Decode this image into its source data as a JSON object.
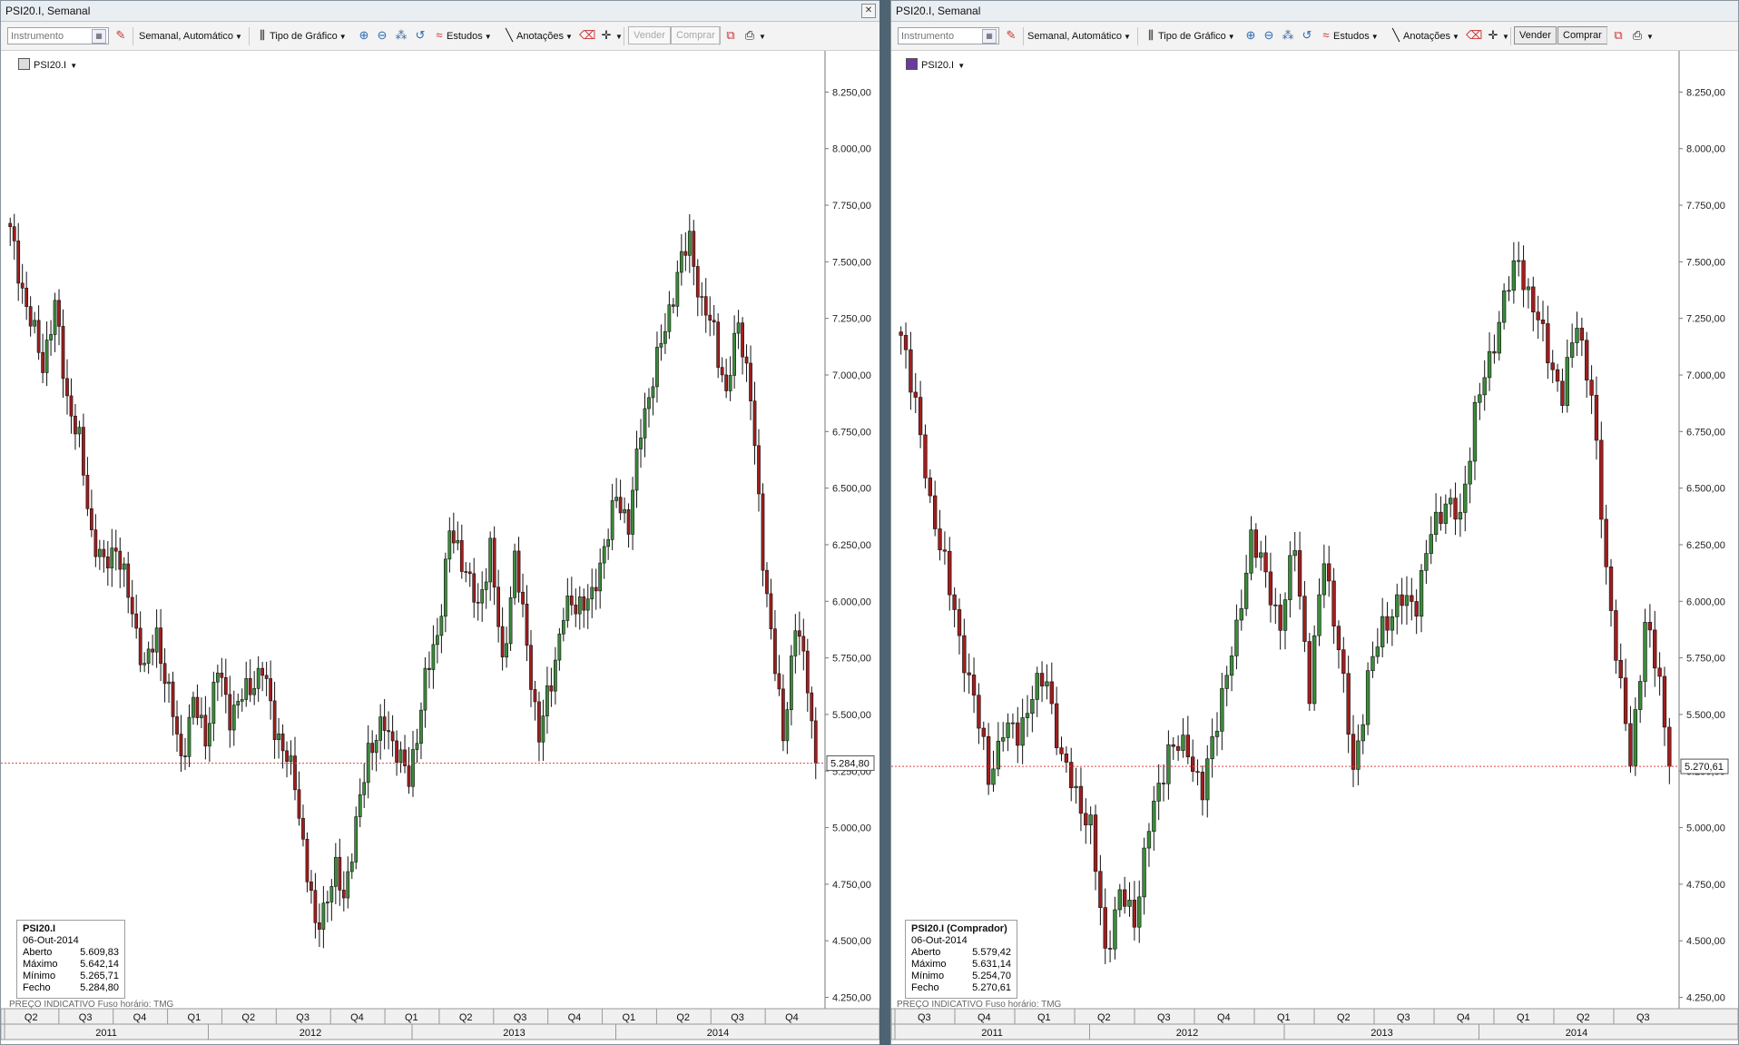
{
  "left": {
    "title": "PSI20.I, Semanal",
    "toolbar": {
      "instrument_placeholder": "Instrumento",
      "period": "Semanal,  Automático",
      "chart_type": "Tipo de Gráfico",
      "studies": "Estudos",
      "annotations": "Anotações",
      "sell": "Vender",
      "buy": "Comprar"
    },
    "symbol": "PSI20.I",
    "price_tag": "5.284,80",
    "footer": "PREÇO INDICATIVO    Fuso horário: TMG",
    "info": {
      "name": "PSI20.I",
      "date": "06-Out-2014",
      "rows": [
        {
          "label": "Aberto",
          "value": "5.609,83"
        },
        {
          "label": "Máximo",
          "value": "5.642,14"
        },
        {
          "label": "Mínimo",
          "value": "5.265,71"
        },
        {
          "label": "Fecho",
          "value": "5.284,80"
        }
      ]
    },
    "quarters": [
      "Q2",
      "Q3",
      "Q4",
      "Q1",
      "Q2",
      "Q3",
      "Q4",
      "Q1",
      "Q2",
      "Q3",
      "Q4",
      "Q1",
      "Q2",
      "Q3",
      "Q4"
    ],
    "years": [
      "2011",
      "2012",
      "2013",
      "2014"
    ]
  },
  "right": {
    "title": "PSI20.I, Semanal",
    "toolbar": {
      "instrument_placeholder": "Instrumento",
      "period": "Semanal,  Automático",
      "chart_type": "Tipo de Gráfico",
      "studies": "Estudos",
      "annotations": "Anotações",
      "sell": "Vender",
      "buy": "Comprar"
    },
    "symbol": "PSI20.I",
    "price_tag": "5.270,61",
    "footer": "PREÇO INDICATIVO    Fuso horário: TMG",
    "info": {
      "name": "PSI20.I (Comprador)",
      "date": "06-Out-2014",
      "rows": [
        {
          "label": "Aberto",
          "value": "5.579,42"
        },
        {
          "label": "Máximo",
          "value": "5.631,14"
        },
        {
          "label": "Mínimo",
          "value": "5.254,70"
        },
        {
          "label": "Fecho",
          "value": "5.270,61"
        }
      ]
    },
    "quarters": [
      "Q3",
      "Q4",
      "Q1",
      "Q2",
      "Q3",
      "Q4",
      "Q1",
      "Q2",
      "Q3",
      "Q4",
      "Q1",
      "Q2",
      "Q3"
    ],
    "years": [
      "2011",
      "2012",
      "2013",
      "2014"
    ]
  },
  "colors": {
    "up": "#3c8b3c",
    "down": "#a01e1e",
    "price_line": "#e04040"
  },
  "chart_data": [
    {
      "type": "candlestick",
      "title": "PSI20.I, Semanal",
      "ylim": [
        4200,
        8400
      ],
      "yticks": [
        "4.250,00",
        "4.500,00",
        "4.750,00",
        "5.000,00",
        "5.250,00",
        "5.500,00",
        "5.750,00",
        "6.000,00",
        "6.250,00",
        "6.500,00",
        "6.750,00",
        "7.000,00",
        "7.250,00",
        "7.500,00",
        "7.750,00",
        "8.000,00",
        "8.250,00"
      ],
      "last": 5284.8,
      "close_path": [
        [
          0,
          7630
        ],
        [
          4,
          7300
        ],
        [
          8,
          7050
        ],
        [
          11,
          7300
        ],
        [
          14,
          6900
        ],
        [
          17,
          6700
        ],
        [
          20,
          6300
        ],
        [
          23,
          6150
        ],
        [
          26,
          6250
        ],
        [
          30,
          5950
        ],
        [
          33,
          5700
        ],
        [
          36,
          5850
        ],
        [
          40,
          5500
        ],
        [
          42,
          5300
        ],
        [
          45,
          5550
        ],
        [
          48,
          5400
        ],
        [
          51,
          5700
        ],
        [
          54,
          5500
        ],
        [
          58,
          5600
        ],
        [
          62,
          5700
        ],
        [
          65,
          5450
        ],
        [
          68,
          5300
        ],
        [
          70,
          5200
        ],
        [
          73,
          4800
        ],
        [
          75,
          4550
        ],
        [
          77,
          4650
        ],
        [
          80,
          4800
        ],
        [
          82,
          4700
        ],
        [
          85,
          5000
        ],
        [
          88,
          5350
        ],
        [
          92,
          5450
        ],
        [
          95,
          5350
        ],
        [
          98,
          5200
        ],
        [
          102,
          5650
        ],
        [
          105,
          5850
        ],
        [
          108,
          6300
        ],
        [
          112,
          6150
        ],
        [
          115,
          5950
        ],
        [
          118,
          6250
        ],
        [
          121,
          5700
        ],
        [
          124,
          6200
        ],
        [
          127,
          5800
        ],
        [
          130,
          5400
        ],
        [
          133,
          5650
        ],
        [
          136,
          5950
        ],
        [
          140,
          6000
        ],
        [
          143,
          6000
        ],
        [
          146,
          6250
        ],
        [
          149,
          6450
        ],
        [
          152,
          6350
        ],
        [
          155,
          6750
        ],
        [
          158,
          7000
        ],
        [
          161,
          7200
        ],
        [
          164,
          7450
        ],
        [
          167,
          7600
        ],
        [
          170,
          7300
        ],
        [
          173,
          7200
        ],
        [
          176,
          6900
        ],
        [
          179,
          7250
        ],
        [
          182,
          6900
        ],
        [
          185,
          6200
        ],
        [
          188,
          5700
        ],
        [
          190,
          5400
        ],
        [
          193,
          5900
        ],
        [
          196,
          5650
        ],
        [
          198,
          5285
        ]
      ]
    },
    {
      "type": "candlestick",
      "title": "PSI20.I, Semanal",
      "ylim": [
        4200,
        8400
      ],
      "yticks": [
        "4.250,00",
        "4.500,00",
        "4.750,00",
        "5.000,00",
        "5.250,00",
        "5.500,00",
        "5.750,00",
        "6.000,00",
        "6.250,00",
        "6.500,00",
        "6.750,00",
        "7.000,00",
        "7.250,00",
        "7.500,00",
        "7.750,00",
        "8.000,00",
        "8.250,00"
      ],
      "last": 5270.61,
      "close_path": [
        [
          0,
          7150
        ],
        [
          3,
          6900
        ],
        [
          6,
          6400
        ],
        [
          9,
          6200
        ],
        [
          12,
          5800
        ],
        [
          15,
          5600
        ],
        [
          18,
          5200
        ],
        [
          21,
          5450
        ],
        [
          24,
          5400
        ],
        [
          27,
          5600
        ],
        [
          30,
          5650
        ],
        [
          33,
          5300
        ],
        [
          36,
          5150
        ],
        [
          39,
          5000
        ],
        [
          42,
          4450
        ],
        [
          45,
          4700
        ],
        [
          48,
          4600
        ],
        [
          51,
          5000
        ],
        [
          55,
          5350
        ],
        [
          59,
          5350
        ],
        [
          62,
          5150
        ],
        [
          66,
          5600
        ],
        [
          69,
          5850
        ],
        [
          72,
          6300
        ],
        [
          75,
          6100
        ],
        [
          78,
          5900
        ],
        [
          81,
          6250
        ],
        [
          84,
          5600
        ],
        [
          87,
          6200
        ],
        [
          90,
          5800
        ],
        [
          93,
          5250
        ],
        [
          96,
          5650
        ],
        [
          99,
          5900
        ],
        [
          103,
          6000
        ],
        [
          106,
          6000
        ],
        [
          109,
          6300
        ],
        [
          112,
          6450
        ],
        [
          115,
          6350
        ],
        [
          118,
          6850
        ],
        [
          121,
          7050
        ],
        [
          124,
          7350
        ],
        [
          127,
          7500
        ],
        [
          130,
          7300
        ],
        [
          133,
          7100
        ],
        [
          136,
          6900
        ],
        [
          139,
          7250
        ],
        [
          142,
          6900
        ],
        [
          145,
          6150
        ],
        [
          148,
          5600
        ],
        [
          150,
          5300
        ],
        [
          153,
          5900
        ],
        [
          156,
          5650
        ],
        [
          158,
          5271
        ]
      ]
    }
  ]
}
